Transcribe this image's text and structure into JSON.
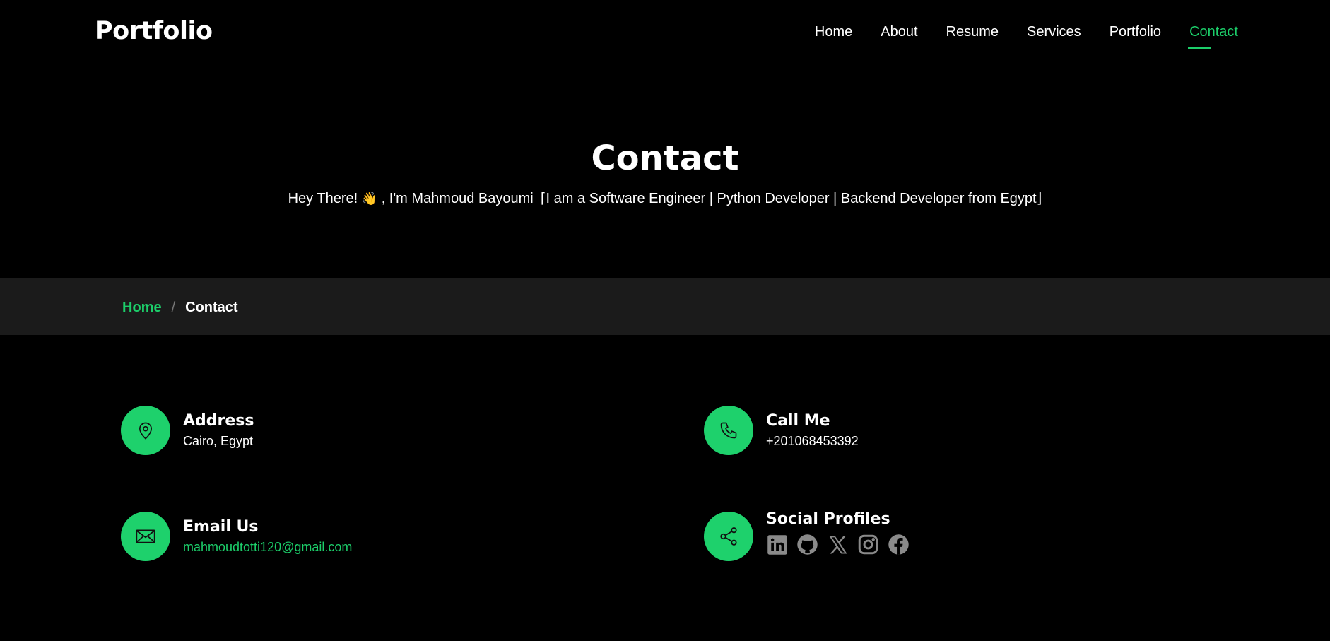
{
  "header": {
    "logo": "Portfolio",
    "nav": [
      "Home",
      "About",
      "Resume",
      "Services",
      "Portfolio",
      "Contact"
    ],
    "active": "Contact"
  },
  "hero": {
    "title": "Contact",
    "greeting": "Hey There! ",
    "wave": "👋",
    "intro": " , I'm Mahmoud Bayoumi",
    "typed": "⌈I am a Software Engineer | Python Developer | Backend Developer from Egypt⌋"
  },
  "breadcrumb": {
    "home": "Home",
    "separator": "/",
    "current": "Contact"
  },
  "contact": {
    "address": {
      "title": "Address",
      "value": "Cairo, Egypt",
      "icon": "map-pin-icon"
    },
    "phone": {
      "title": "Call Me",
      "value": "+201068453392",
      "icon": "phone-icon"
    },
    "email": {
      "title": "Email Us",
      "value": "mahmoudtotti120@gmail.com",
      "icon": "envelope-icon"
    },
    "social": {
      "title": "Social Profiles",
      "icon": "share-icon",
      "profiles": [
        "linkedin-icon",
        "github-icon",
        "x-icon",
        "instagram-icon",
        "facebook-icon"
      ]
    }
  },
  "colors": {
    "accent": "#1cce6a",
    "background": "#000000",
    "bar": "#1b1b1b",
    "social_icon": "#8a8a8a"
  }
}
